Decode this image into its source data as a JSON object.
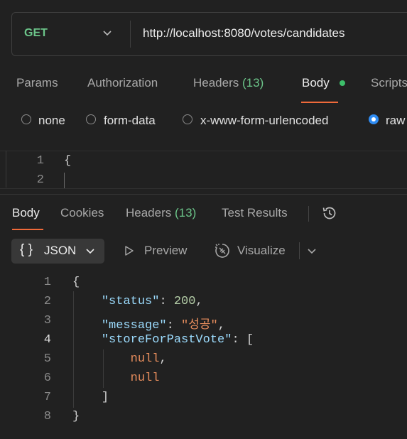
{
  "request": {
    "method": "GET",
    "url": "http://localhost:8080/votes/candidates"
  },
  "request_tabs": {
    "params": "Params",
    "authorization": "Authorization",
    "headers_label": "Headers",
    "headers_count": "(13)",
    "body": "Body",
    "scripts": "Scripts"
  },
  "body_types": {
    "none": "none",
    "form_data": "form-data",
    "urlencoded": "x-www-form-urlencoded",
    "raw": "raw",
    "selected": "raw"
  },
  "request_editor": {
    "lines": [
      {
        "num": "1",
        "text": "{"
      },
      {
        "num": "2",
        "text": ""
      }
    ]
  },
  "response_tabs": {
    "body": "Body",
    "cookies": "Cookies",
    "headers_label": "Headers",
    "headers_count": "(13)",
    "test_results": "Test Results"
  },
  "response_toolbar": {
    "braces": "{ }",
    "format": "JSON",
    "preview": "Preview",
    "visualize": "Visualize"
  },
  "response": {
    "line_numbers": [
      "1",
      "2",
      "3",
      "4",
      "5",
      "6",
      "7",
      "8"
    ],
    "open_brace": "{",
    "status_key": "\"status\"",
    "status_value": "200",
    "message_key": "\"message\"",
    "message_value": "\"성공\"",
    "store_key": "\"storeForPastVote\"",
    "array_open": "[",
    "null1": "null",
    "null2": "null",
    "array_close": "]",
    "close_brace": "}"
  },
  "colors": {
    "accent_orange": "#ef6a3a",
    "method_green": "#6cc58a",
    "radio_blue": "#2f8cf3"
  }
}
